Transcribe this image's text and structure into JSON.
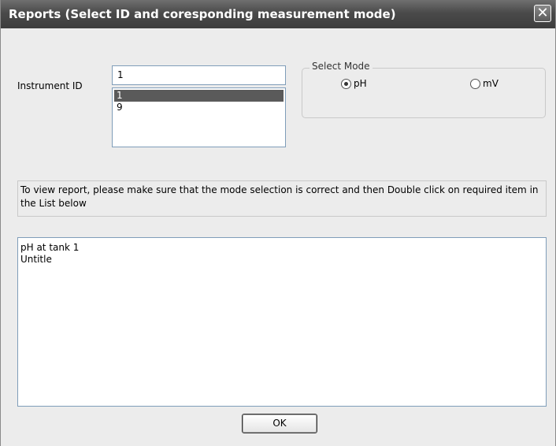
{
  "window": {
    "title": "Reports (Select ID and coresponding measurement mode)",
    "close_glyph": "✕"
  },
  "instrument": {
    "label": "Instrument ID",
    "input_value": "1",
    "list_items": [
      "1",
      "9"
    ],
    "selected_index": 0
  },
  "mode": {
    "legend": "Select Mode",
    "options": [
      {
        "label": "pH",
        "selected": true
      },
      {
        "label": "mV",
        "selected": false
      }
    ]
  },
  "instructions": "To view report, please make sure that the mode selection is correct and then Double click on required item in the List below",
  "reports": {
    "items": [
      "pH at tank 1",
      "Untitle"
    ]
  },
  "buttons": {
    "ok_label": "OK"
  },
  "icons": {
    "close": "close-icon",
    "radio": "radio-button-icon"
  }
}
